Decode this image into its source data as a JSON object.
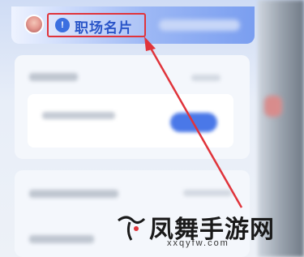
{
  "header": {
    "card_label": "职场名片",
    "card_icon": "shield-icon"
  },
  "watermark": {
    "title": "凤舞手游网",
    "url": "xxqyfw.com"
  },
  "colors": {
    "highlight_border": "#e0343b",
    "accent_blue": "#3b6fe0",
    "arrow_red": "#e0343b"
  }
}
